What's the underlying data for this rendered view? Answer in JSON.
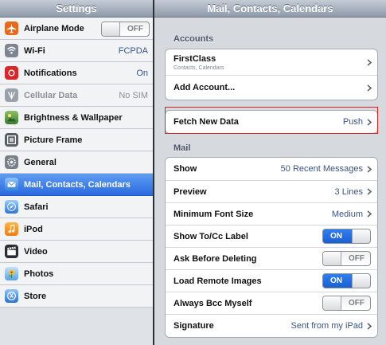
{
  "left": {
    "title": "Settings",
    "items": [
      {
        "label": "Airplane Mode",
        "toggle": "OFF",
        "icon": "airplane-icon",
        "color": "#e66a1a"
      },
      {
        "label": "Wi-Fi",
        "value": "FCPDA",
        "icon": "wifi-icon",
        "color": "#7d8591"
      },
      {
        "label": "Notifications",
        "value": "On",
        "icon": "notifications-icon",
        "color": "#d8262a"
      },
      {
        "label": "Cellular Data",
        "value": "No SIM",
        "icon": "cellular-data-icon",
        "color": "#9aa1a8",
        "disabled": true
      },
      {
        "label": "Brightness & Wallpaper",
        "icon": "brightness-icon",
        "color": "#4a8b3a"
      },
      {
        "label": "Picture Frame",
        "icon": "picture-frame-icon",
        "color": "#5a5f66"
      },
      {
        "label": "General",
        "icon": "gear-icon",
        "color": "#7a8088"
      },
      {
        "label": "Mail, Contacts, Calendars",
        "icon": "mail-icon",
        "color": "#3c8ee6",
        "selected": true
      },
      {
        "label": "Safari",
        "icon": "safari-icon",
        "color": "#3f8fe0"
      },
      {
        "label": "iPod",
        "icon": "ipod-icon",
        "color": "#f08a1c"
      },
      {
        "label": "Video",
        "icon": "video-icon",
        "color": "#2a2d33"
      },
      {
        "label": "Photos",
        "icon": "photos-icon",
        "color": "#e9a31b"
      },
      {
        "label": "Store",
        "icon": "store-icon",
        "color": "#3d86d9"
      }
    ]
  },
  "right": {
    "title": "Mail, Contacts, Calendars",
    "accounts_header": "Accounts",
    "accounts": [
      {
        "label": "FirstClass",
        "sub": "Contacts, Calendars"
      },
      {
        "label": "Add Account..."
      }
    ],
    "fetch": {
      "label": "Fetch New Data",
      "value": "Push"
    },
    "mail_header": "Mail",
    "mail": [
      {
        "label": "Show",
        "value": "50 Recent Messages"
      },
      {
        "label": "Preview",
        "value": "3 Lines"
      },
      {
        "label": "Minimum Font Size",
        "value": "Medium"
      },
      {
        "label": "Show To/Cc Label",
        "toggle": "ON"
      },
      {
        "label": "Ask Before Deleting",
        "toggle": "OFF"
      },
      {
        "label": "Load Remote Images",
        "toggle": "ON"
      },
      {
        "label": "Always Bcc Myself",
        "toggle": "OFF"
      },
      {
        "label": "Signature",
        "value": "Sent from my iPad"
      }
    ]
  }
}
